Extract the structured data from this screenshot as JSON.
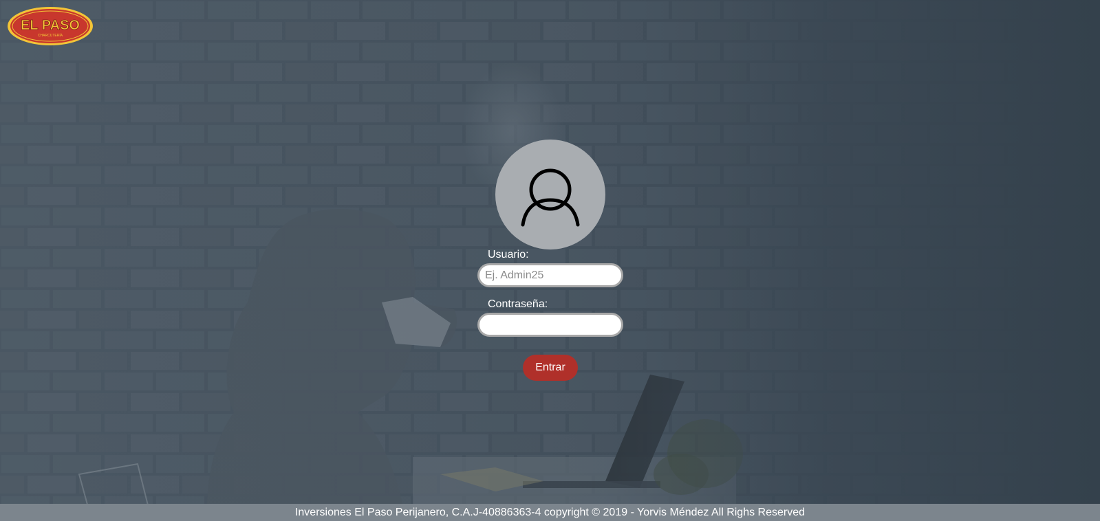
{
  "brand": {
    "logo_text": "EL PASO",
    "logo_subtext": "CHARCUTERÍA"
  },
  "login": {
    "user_label": "Usuario:",
    "user_placeholder": "Ej. Admin25",
    "user_value": "",
    "password_label": "Contraseña:",
    "password_value": "",
    "submit_label": "Entrar",
    "avatar_icon": "user-icon"
  },
  "footer": {
    "text": "Inversiones El Paso Perijanero, C.A.J-40886363-4 copyright © 2019 - Yorvis Méndez All Righs Reserved"
  },
  "colors": {
    "button": "#b0302a",
    "footer_bar": "#7c858d",
    "avatar_circle": "#a9adb1",
    "logo_red": "#c8372d",
    "logo_gold": "#f3c437"
  }
}
